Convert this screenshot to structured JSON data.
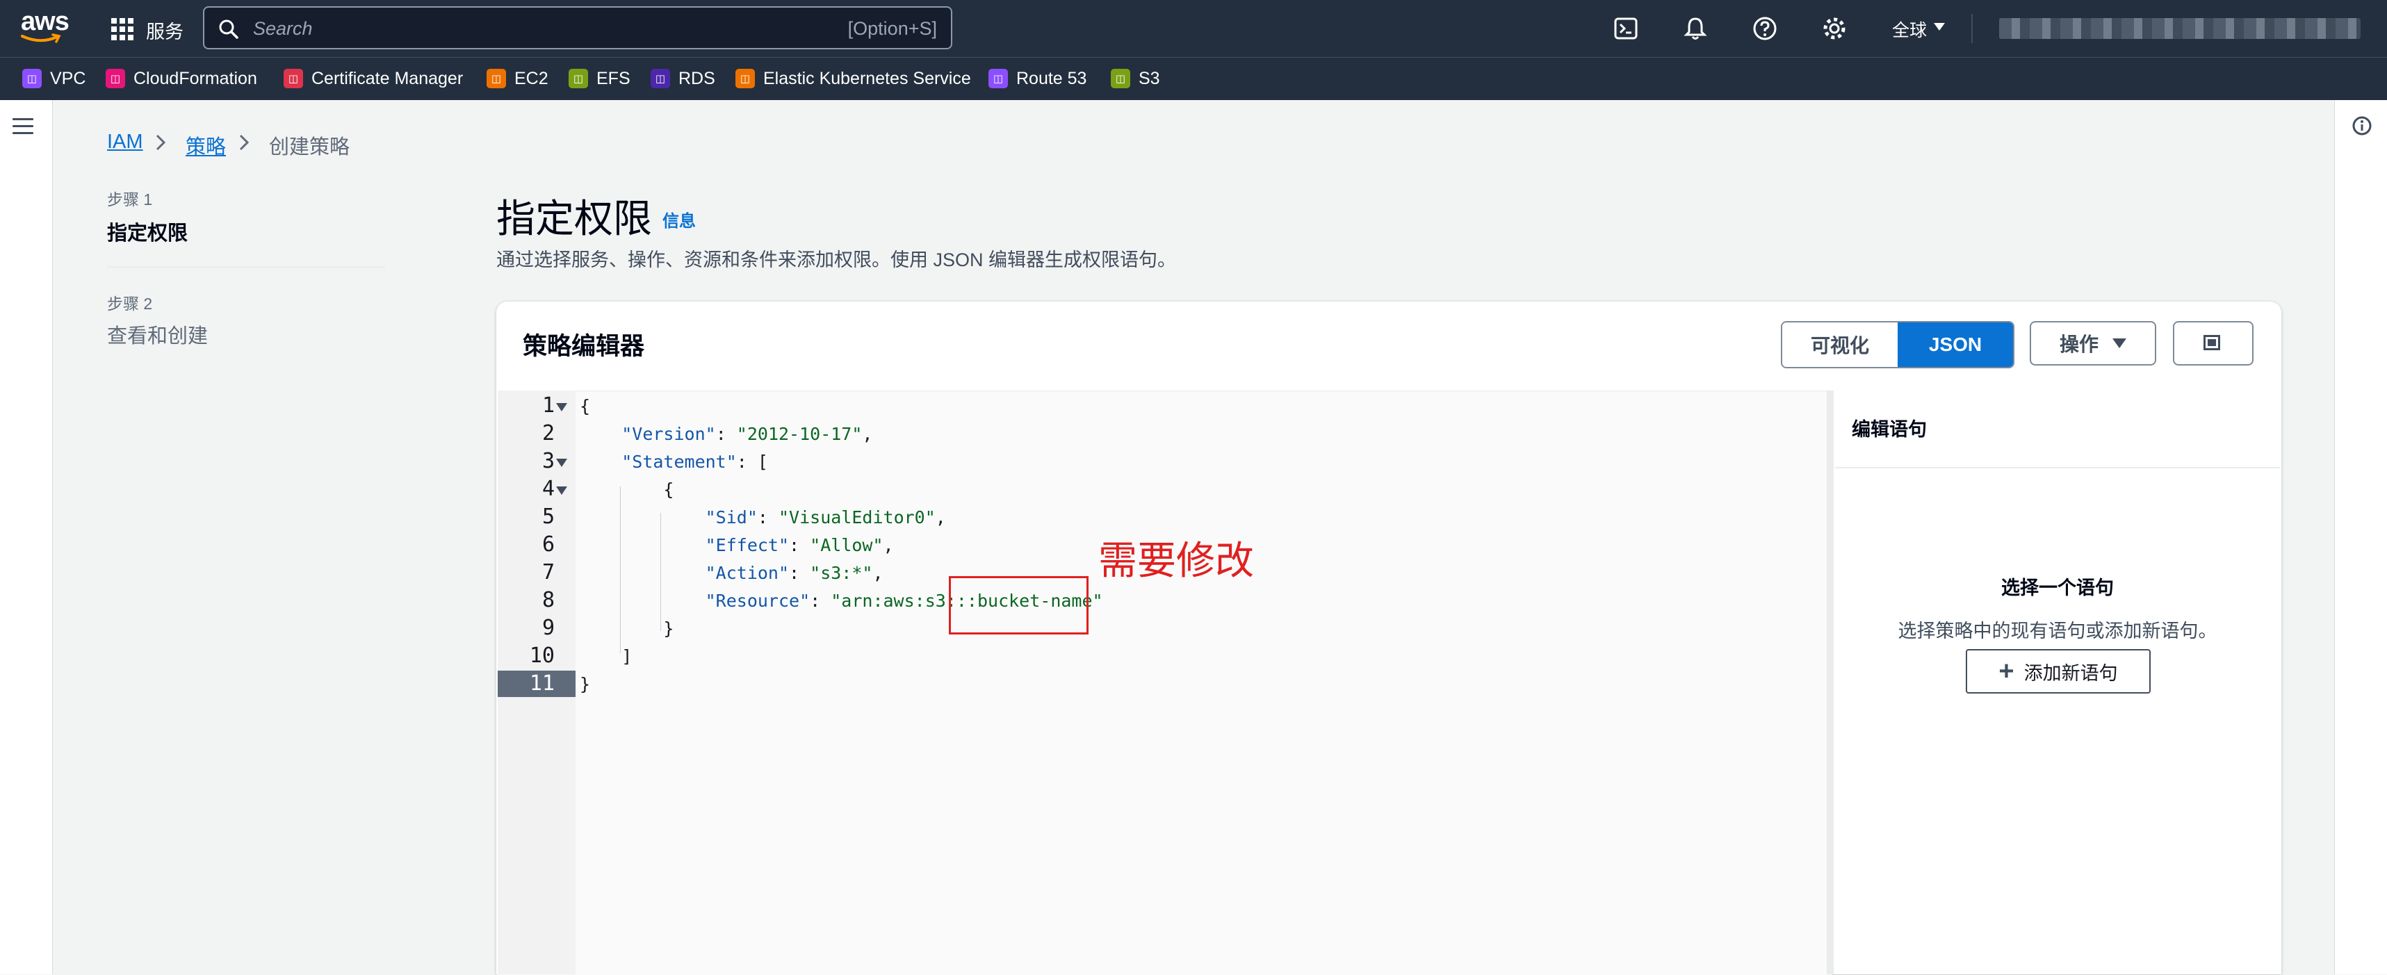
{
  "topnav": {
    "logo": "aws",
    "services_label": "服务",
    "search_placeholder": "Search",
    "search_shortcut": "[Option+S]",
    "region_label": "全球",
    "icons": [
      "cloudshell-icon",
      "bell-icon",
      "help-icon",
      "gear-icon"
    ]
  },
  "favorites": [
    {
      "label": "VPC",
      "color": "#8c4fff"
    },
    {
      "label": "CloudFormation",
      "color": "#e7157b"
    },
    {
      "label": "Certificate Manager",
      "color": "#dd344c"
    },
    {
      "label": "EC2",
      "color": "#ed7100"
    },
    {
      "label": "EFS",
      "color": "#7aa116"
    },
    {
      "label": "RDS",
      "color": "#4d27aa"
    },
    {
      "label": "Elastic Kubernetes Service",
      "color": "#ed7100"
    },
    {
      "label": "Route 53",
      "color": "#8c4fff"
    },
    {
      "label": "S3",
      "color": "#7aa116"
    }
  ],
  "breadcrumb": {
    "items": [
      "IAM",
      "策略"
    ],
    "current": "创建策略"
  },
  "steps": [
    {
      "number": "步骤 1",
      "title": "指定权限"
    },
    {
      "number": "步骤 2",
      "title": "查看和创建"
    }
  ],
  "page": {
    "title": "指定权限",
    "info_link": "信息",
    "description": "通过选择服务、操作、资源和条件来添加权限。使用 JSON 编辑器生成权限语句。"
  },
  "editor": {
    "title": "策略编辑器",
    "toggle_visual": "可视化",
    "toggle_json": "JSON",
    "actions_label": "操作",
    "line_numbers": [
      "1",
      "2",
      "3",
      "4",
      "5",
      "6",
      "7",
      "8",
      "9",
      "10",
      "11"
    ],
    "active_line": 11,
    "code": {
      "l1": "{",
      "l2_key": "\"Version\"",
      "l2_val": "\"2012-10-17\"",
      "l3_key": "\"Statement\"",
      "l4": "{",
      "l5_key": "\"Sid\"",
      "l5_val": "\"VisualEditor0\"",
      "l6_key": "\"Effect\"",
      "l6_val": "\"Allow\"",
      "l7_key": "\"Action\"",
      "l7_val": "\"s3:*\"",
      "l8_key": "\"Resource\"",
      "l8_val": "\"arn:aws:s3:::bucket-name\"",
      "l9": "}",
      "l10": "]",
      "l11": "}"
    },
    "annotation": "需要修改",
    "annotation_color": "#e02020"
  },
  "side_panel": {
    "title": "编辑语句",
    "empty_heading": "选择一个语句",
    "empty_text": "选择策略中的现有语句或添加新语句。",
    "add_button": "添加新语句"
  }
}
